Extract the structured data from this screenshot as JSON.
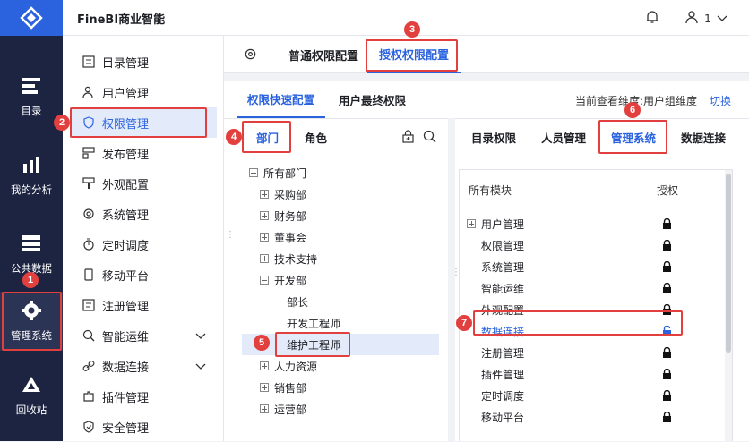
{
  "app": {
    "title": "FineBI商业智能",
    "user": "1"
  },
  "leftbar": {
    "items": [
      {
        "label": "目录",
        "icon": "catalog-icon"
      },
      {
        "label": "我的分析",
        "icon": "analysis-icon"
      },
      {
        "label": "公共数据",
        "icon": "public-data-icon"
      },
      {
        "label": "管理系统",
        "icon": "gear-icon"
      },
      {
        "label": "回收站",
        "icon": "recycle-icon"
      }
    ]
  },
  "menu": {
    "items": [
      {
        "label": "目录管理"
      },
      {
        "label": "用户管理"
      },
      {
        "label": "权限管理"
      },
      {
        "label": "发布管理"
      },
      {
        "label": "外观配置"
      },
      {
        "label": "系统管理"
      },
      {
        "label": "定时调度"
      },
      {
        "label": "移动平台"
      },
      {
        "label": "注册管理"
      },
      {
        "label": "智能运维"
      },
      {
        "label": "数据连接"
      },
      {
        "label": "插件管理"
      },
      {
        "label": "安全管理"
      }
    ]
  },
  "top_tabs": {
    "normal": "普通权限配置",
    "grant": "授权权限配置"
  },
  "sub_tabs": {
    "quick": "权限快速配置",
    "final": "用户最终权限"
  },
  "dimension": {
    "label": "当前查看维度:用户组维度",
    "switch": "切换"
  },
  "left_panel": {
    "tabs": {
      "dept": "部门",
      "role": "角色"
    },
    "tree": [
      {
        "label": "所有部门"
      },
      {
        "label": "采购部"
      },
      {
        "label": "财务部"
      },
      {
        "label": "董事会"
      },
      {
        "label": "技术支持"
      },
      {
        "label": "开发部"
      },
      {
        "label": "部长"
      },
      {
        "label": "开发工程师"
      },
      {
        "label": "维护工程师"
      },
      {
        "label": "人力资源"
      },
      {
        "label": "销售部"
      },
      {
        "label": "运营部"
      }
    ]
  },
  "right_panel": {
    "tabs": {
      "catalog": "目录权限",
      "people": "人员管理",
      "manage": "管理系统",
      "data": "数据连接"
    },
    "header": {
      "module": "所有模块",
      "auth": "授权"
    },
    "modules": [
      {
        "label": "用户管理"
      },
      {
        "label": "权限管理"
      },
      {
        "label": "系统管理"
      },
      {
        "label": "智能运维"
      },
      {
        "label": "外观配置"
      },
      {
        "label": "数据连接"
      },
      {
        "label": "注册管理"
      },
      {
        "label": "插件管理"
      },
      {
        "label": "定时调度"
      },
      {
        "label": "移动平台"
      }
    ]
  },
  "annotations": [
    "1",
    "2",
    "3",
    "4",
    "5",
    "6",
    "7"
  ],
  "colors": {
    "accent": "#2b63df",
    "sidebar": "#1d2442",
    "annotation": "#e2403e"
  }
}
